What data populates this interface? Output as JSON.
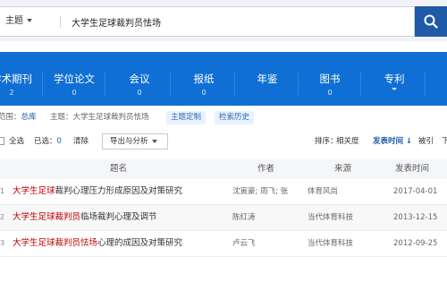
{
  "search": {
    "field": "主题",
    "query": "大学生足球裁判员怯场"
  },
  "db_tabs": [
    {
      "label": "学术期刊",
      "count": "2"
    },
    {
      "label": "学位论文",
      "count": "0"
    },
    {
      "label": "会议",
      "count": "0"
    },
    {
      "label": "报纸",
      "count": "0"
    },
    {
      "label": "年鉴",
      "count": ""
    },
    {
      "label": "图书",
      "count": "0"
    },
    {
      "label": "专利",
      "count": ""
    }
  ],
  "scope": {
    "label": "范围：",
    "value": "总库",
    "topic": "主题：大学生足球裁判员怯场",
    "custom_btn": "主题定制",
    "history_btn": "检索历史"
  },
  "toolbar": {
    "select_all": "全选",
    "selected_label": "已选：",
    "selected_count": "0",
    "clear": "清除",
    "export": "导出与分析",
    "sort_label": "排序：",
    "sort_relevance": "相关度",
    "sort_date": "发表时间",
    "sort_cited": "被引",
    "sort_more": "下"
  },
  "table": {
    "headers": {
      "title": "题名",
      "author": "作者",
      "source": "来源",
      "date": "发表时间"
    },
    "rows": [
      {
        "num": "1",
        "title_hl": "大学生足球",
        "title_rest": "裁判心理压力形成原因及对策研究",
        "author": "沈寅豪; 周飞; 张铖",
        "source": "体育风尚",
        "date": "2017-04-01"
      },
      {
        "num": "2",
        "title_hl": "大学生足球裁判员",
        "title_rest": "临场裁判心理及调节",
        "author": "陈红涛",
        "source": "当代体育科技",
        "date": "2013-12-15"
      },
      {
        "num": "3",
        "title_hl": "大学生足球裁判员怯场",
        "title_rest": "心理的成因及对策研究",
        "author": "卢云飞",
        "source": "当代体育科技",
        "date": "2012-09-25"
      }
    ]
  },
  "colors": {
    "primary_blue": "#0f6fd4",
    "search_button": "#1e5aa8",
    "highlight_red": "#c00000"
  }
}
